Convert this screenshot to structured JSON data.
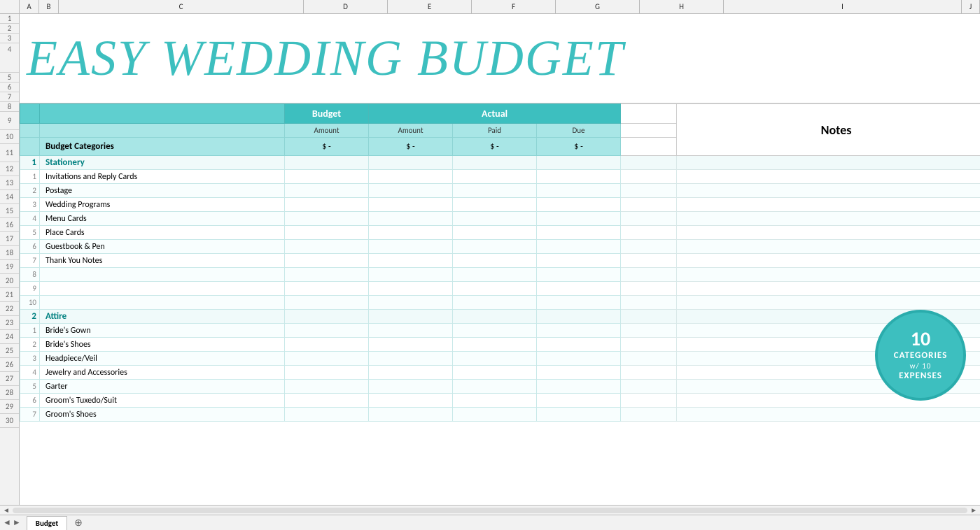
{
  "title": "EASY WEDDING BUDGET",
  "header": {
    "budget_label": "Budget",
    "actual_label": "Actual",
    "amount_label": "Amount",
    "paid_label": "Paid",
    "due_label": "Due",
    "notes_label": "Notes",
    "categories_label": "Budget Categories",
    "dollar_dash": "$ -"
  },
  "badge": {
    "num1": "10",
    "text1": "CATEGORIES",
    "connector": "w/ 10",
    "text2": "EXPENSES"
  },
  "tabs": [
    {
      "label": "Budget",
      "active": true
    }
  ],
  "col_letters": [
    "A",
    "B",
    "C",
    "D",
    "E",
    "F",
    "G",
    "H",
    "I",
    "J"
  ],
  "row_numbers": [
    "1",
    "2",
    "3",
    "4",
    "5",
    "6",
    "7",
    "8",
    "9",
    "10",
    "11",
    "12",
    "13",
    "14",
    "15",
    "16",
    "17",
    "18",
    "19",
    "20",
    "21",
    "22",
    "23",
    "24",
    "25",
    "26",
    "27",
    "28",
    "29",
    "30"
  ],
  "categories": [
    {
      "num": "1",
      "name": "Stationery",
      "items": [
        {
          "num": "1",
          "name": "Invitations and Reply Cards"
        },
        {
          "num": "2",
          "name": "Postage"
        },
        {
          "num": "3",
          "name": "Wedding Programs"
        },
        {
          "num": "4",
          "name": "Menu Cards"
        },
        {
          "num": "5",
          "name": "Place Cards"
        },
        {
          "num": "6",
          "name": "Guestbook & Pen"
        },
        {
          "num": "7",
          "name": "Thank You Notes"
        },
        {
          "num": "8",
          "name": ""
        },
        {
          "num": "9",
          "name": ""
        },
        {
          "num": "10",
          "name": ""
        }
      ]
    },
    {
      "num": "2",
      "name": "Attire",
      "items": [
        {
          "num": "1",
          "name": "Bride's Gown"
        },
        {
          "num": "2",
          "name": "Bride's Shoes"
        },
        {
          "num": "3",
          "name": "Headpiece/Veil"
        },
        {
          "num": "4",
          "name": "Jewelry and Accessories"
        },
        {
          "num": "5",
          "name": "Garter"
        },
        {
          "num": "6",
          "name": "Groom's Tuxedo/Suit"
        },
        {
          "num": "7",
          "name": "Groom's Shoes"
        }
      ]
    }
  ]
}
